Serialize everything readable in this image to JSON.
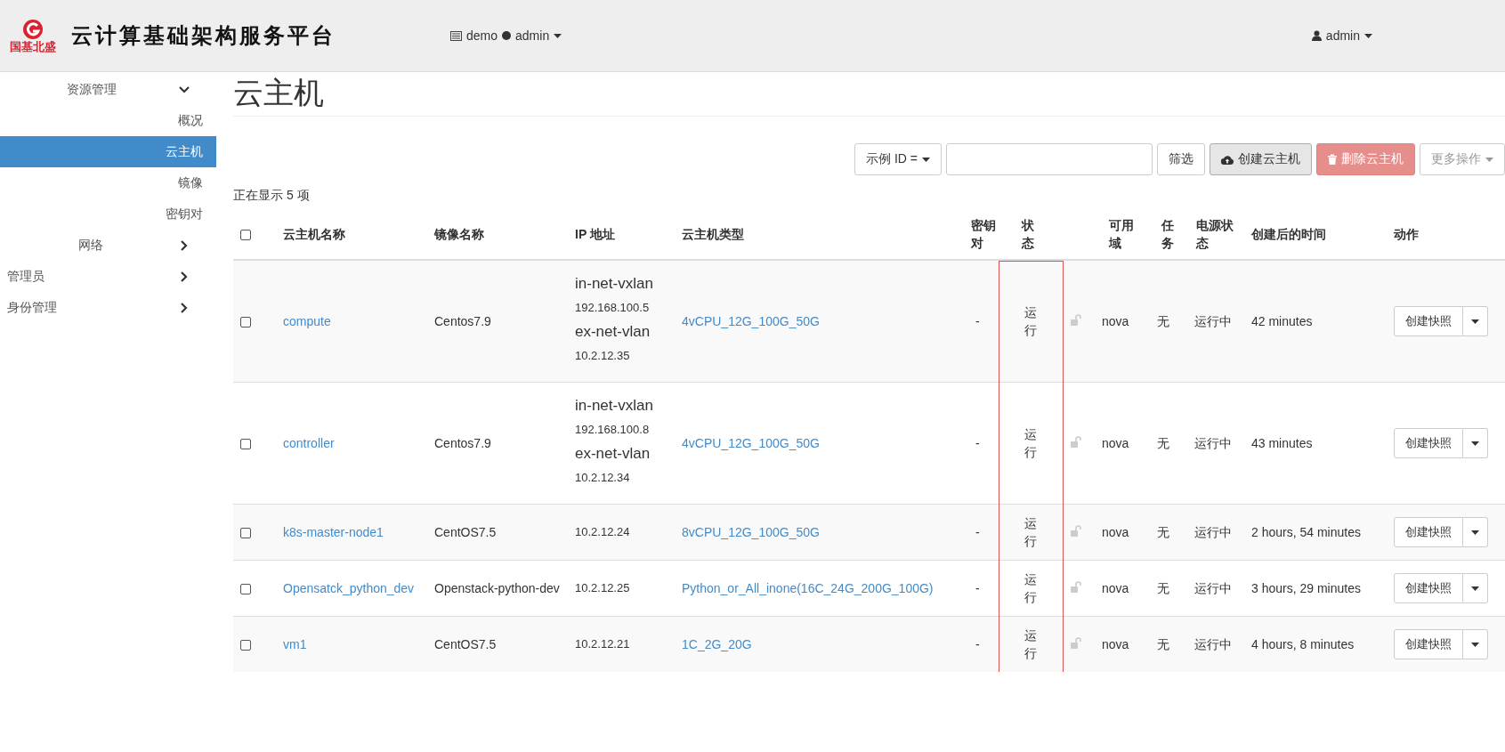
{
  "header": {
    "logo_text": "国基北盛",
    "title": "云计算基础架构服务平台",
    "project": "demo",
    "project_user": "admin",
    "user": "admin"
  },
  "sidebar": {
    "items": [
      {
        "label": "资源管理",
        "expanded": true,
        "children": [
          {
            "label": "概况",
            "selected": false
          },
          {
            "label": "云主机",
            "selected": true
          },
          {
            "label": "镜像",
            "selected": false
          },
          {
            "label": "密钥对",
            "selected": false
          },
          {
            "label": "网络",
            "expanded": false
          }
        ]
      },
      {
        "label": "管理员",
        "expanded": false
      },
      {
        "label": "身份管理",
        "expanded": false
      }
    ]
  },
  "page_title": "云主机",
  "toolbar": {
    "filter_field": "示例 ID =",
    "filter_button": "筛选",
    "create_button": "创建云主机",
    "delete_button": "删除云主机",
    "delete_disabled": true,
    "more_button": "更多操作"
  },
  "count_text": "正在显示 5 项",
  "table": {
    "select_all_checked": false,
    "status_column_highlighted": true,
    "columns": [
      "云主机名称",
      "镜像名称",
      "IP 地址",
      "云主机类型",
      "密钥对",
      "状态",
      "可用域",
      "任务",
      "电源状态",
      "创建后的时间",
      "动作"
    ],
    "rows": [
      {
        "checked": false,
        "name": "compute",
        "image": "Centos7.9",
        "ip": [
          {
            "network": "in-net-vxlan",
            "address": "192.168.100.5"
          },
          {
            "network": "ex-net-vlan",
            "address": "10.2.12.35"
          }
        ],
        "flavor": "4vCPU_12G_100G_50G",
        "keypair": "-",
        "status": "运行",
        "zone": "nova",
        "task": "无",
        "power": "运行中",
        "age": "42 minutes",
        "action": "创建快照"
      },
      {
        "checked": false,
        "name": "controller",
        "image": "Centos7.9",
        "ip": [
          {
            "network": "in-net-vxlan",
            "address": "192.168.100.8"
          },
          {
            "network": "ex-net-vlan",
            "address": "10.2.12.34"
          }
        ],
        "flavor": "4vCPU_12G_100G_50G",
        "keypair": "-",
        "status": "运行",
        "zone": "nova",
        "task": "无",
        "power": "运行中",
        "age": "43 minutes",
        "action": "创建快照"
      },
      {
        "checked": false,
        "name": "k8s-master-node1",
        "image": "CentOS7.5",
        "ip": [
          {
            "address": "10.2.12.24"
          }
        ],
        "flavor": "8vCPU_12G_100G_50G",
        "keypair": "-",
        "status": "运行",
        "zone": "nova",
        "task": "无",
        "power": "运行中",
        "age": "2 hours, 54 minutes",
        "action": "创建快照"
      },
      {
        "checked": false,
        "name": "Opensatck_python_dev",
        "image": "Openstack-python-dev",
        "ip": [
          {
            "address": "10.2.12.25"
          }
        ],
        "flavor": "Python_or_All_inone(16C_24G_200G_100G)",
        "keypair": "-",
        "status": "运行",
        "zone": "nova",
        "task": "无",
        "power": "运行中",
        "age": "3 hours, 29 minutes",
        "action": "创建快照"
      },
      {
        "checked": false,
        "name": "vm1",
        "image": "CentOS7.5",
        "ip": [
          {
            "address": "10.2.12.21"
          }
        ],
        "flavor": "1C_2G_20G",
        "keypair": "-",
        "status": "运行",
        "zone": "nova",
        "task": "无",
        "power": "运行中",
        "age": "4 hours, 8 minutes",
        "action": "创建快照"
      }
    ]
  }
}
